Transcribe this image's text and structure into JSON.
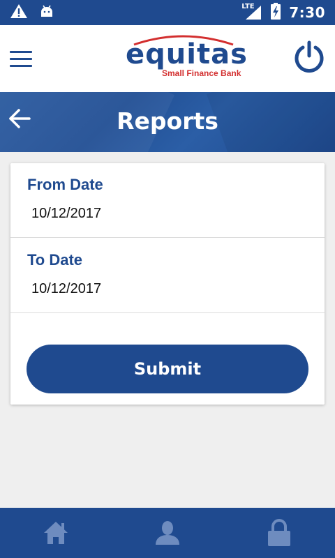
{
  "status_bar": {
    "network": "LTE",
    "time": "7:30"
  },
  "header": {
    "logo_word": "equitas",
    "logo_subtitle": "Small Finance Bank"
  },
  "page": {
    "title": "Reports"
  },
  "form": {
    "from_label": "From Date",
    "from_value": "10/12/2017",
    "to_label": "To Date",
    "to_value": "10/12/2017",
    "submit_label": "Submit"
  },
  "colors": {
    "primary": "#1f4a8f",
    "accent": "#d32f2f",
    "background": "#efefef"
  },
  "icons": {
    "status_left": [
      "warning-icon",
      "android-icon"
    ],
    "status_right": [
      "signal-icon",
      "battery-charging-icon"
    ],
    "nav": [
      "home-icon",
      "profile-icon",
      "lock-icon"
    ]
  }
}
